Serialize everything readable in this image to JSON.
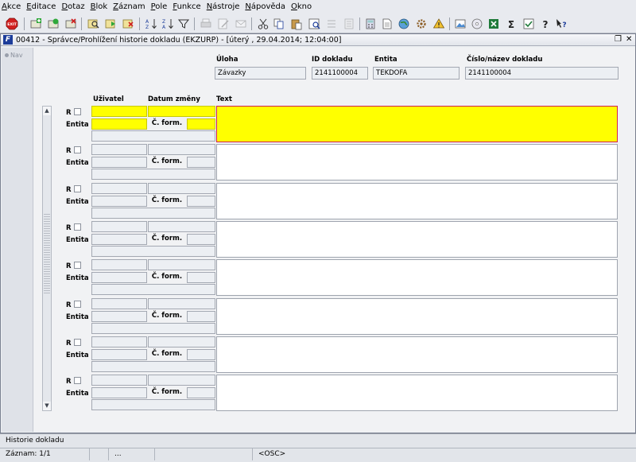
{
  "menu": [
    "Akce",
    "Editace",
    "Dotaz",
    "Blok",
    "Záznam",
    "Pole",
    "Funkce",
    "Nástroje",
    "Nápověda",
    "Okno"
  ],
  "toolbar": {
    "exit_label": "EXIT",
    "icons": [
      "exit-icon",
      "save-icon",
      "new-record-icon",
      "delete-record-icon",
      "enter-query-icon",
      "execute-query-icon",
      "cancel-query-icon",
      "sort-ascending-icon",
      "sort-descending-icon",
      "filter-icon",
      "print-icon",
      "edit-icon",
      "mail-icon",
      "cut-icon",
      "copy-icon",
      "paste-icon",
      "list-values-icon",
      "scroll-icon",
      "document-icon",
      "calculator-icon",
      "attachment-icon",
      "web-icon",
      "settings-icon",
      "note-icon",
      "image-icon",
      "calendar-icon",
      "pencil-icon",
      "cd-icon",
      "excel-icon",
      "sum-icon",
      "check-icon",
      "help-icon",
      "context-help-icon"
    ]
  },
  "window": {
    "title": "00412 - Správce/Prohlížení historie dokladu (EKZURP) - [úterý  , 29.04.2014; 12:04:00]",
    "logo": "F",
    "nav_label": "Nav"
  },
  "header": {
    "uloha_label": "Úloha",
    "uloha_value": "Závazky",
    "id_label": "ID dokladu",
    "id_value": "2141100004",
    "entita_label": "Entita",
    "entita_value": "TEKDOFA",
    "cislo_label": "Číslo/název dokladu",
    "cislo_value": "2141100004"
  },
  "grid": {
    "col_uzivatel": "Uživatel",
    "col_datum": "Datum změny",
    "col_text": "Text",
    "label_r": "R",
    "label_entita": "Entita",
    "button_c_form": "Č. form.",
    "row_count": 8,
    "active_row": 0
  },
  "status": {
    "message": "Historie dokladu",
    "record": "Záznam: 1/1",
    "cell2": "...",
    "mode": "<OSC>"
  }
}
